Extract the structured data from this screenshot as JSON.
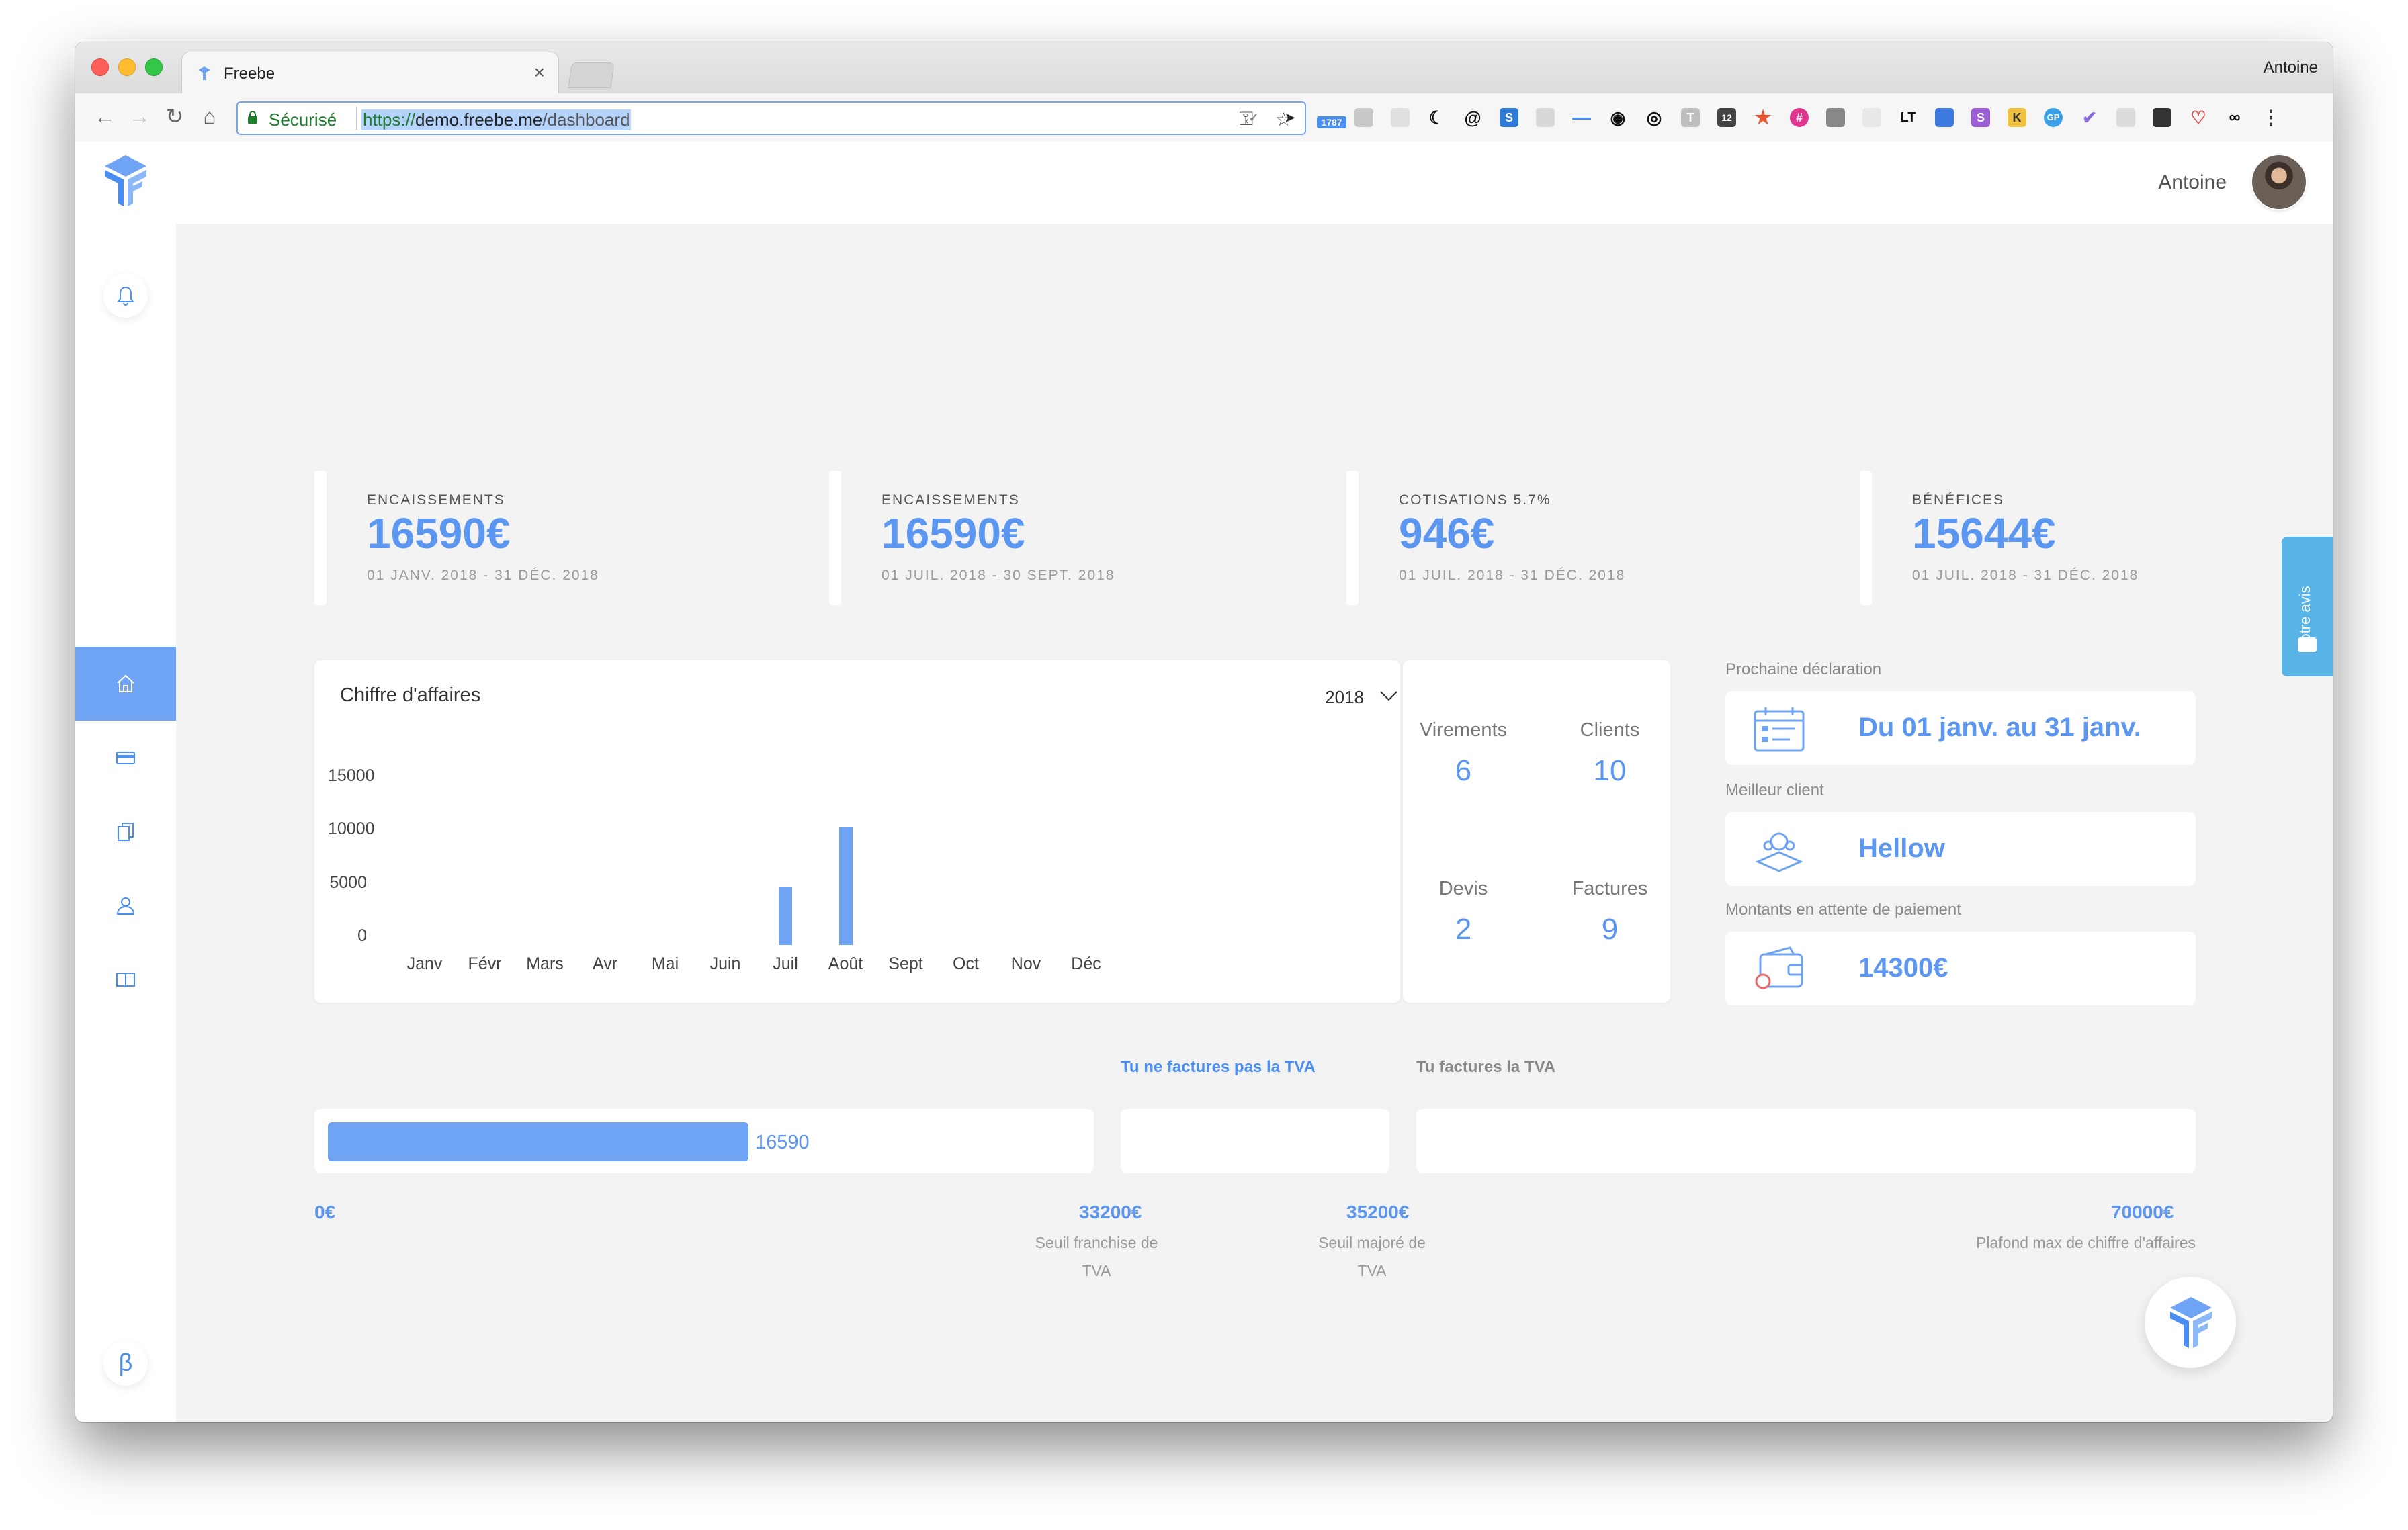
{
  "browser": {
    "tab_title": "Freebe",
    "tab_close": "×",
    "profile_name": "Antoine",
    "secure_label": "Sécurisé",
    "url_scheme": "https://",
    "url_host": "demo.freebe.me",
    "url_path": "/dashboard",
    "extension_badge": "1787",
    "extension_label_lt": "LT",
    "extension_label_12": "12",
    "extension_label_s": "S"
  },
  "header": {
    "user_name": "Antoine"
  },
  "sidebar": {
    "beta_label": "β",
    "items": [
      "home",
      "billing",
      "documents",
      "clients",
      "guide"
    ]
  },
  "stats": [
    {
      "label": "ENCAISSEMENTS",
      "value": "16590€",
      "period": "01 JANV. 2018 - 31 DÉC. 2018"
    },
    {
      "label": "ENCAISSEMENTS",
      "value": "16590€",
      "period": "01 JUIL. 2018 - 30 SEPT. 2018"
    },
    {
      "label": "COTISATIONS 5.7%",
      "value": "946€",
      "period": "01 JUIL. 2018 - 31 DÉC. 2018"
    },
    {
      "label": "BÉNÉFICES",
      "value": "15644€",
      "period": "01 JUIL. 2018 - 31 DÉC. 2018"
    }
  ],
  "revenue": {
    "title": "Chiffre d'affaires",
    "year": "2018"
  },
  "chart_data": {
    "type": "bar",
    "title": "Chiffre d'affaires",
    "categories": [
      "Janv",
      "Févr",
      "Mars",
      "Avr",
      "Mai",
      "Juin",
      "Juil",
      "Août",
      "Sept",
      "Oct",
      "Nov",
      "Déc"
    ],
    "values": [
      0,
      0,
      0,
      0,
      0,
      0,
      5500,
      11000,
      0,
      0,
      0,
      0
    ],
    "yticks": [
      "15000",
      "10000",
      "5000",
      "0"
    ],
    "ytick_values": [
      15000,
      10000,
      5000,
      0
    ],
    "ylim": [
      0,
      15000
    ],
    "bar_color": "#6fa3f4"
  },
  "kpis": [
    {
      "label": "Virements",
      "value": "6"
    },
    {
      "label": "Clients",
      "value": "10"
    },
    {
      "label": "Devis",
      "value": "2"
    },
    {
      "label": "Factures",
      "value": "9"
    }
  ],
  "side": {
    "next_declaration_label": "Prochaine déclaration",
    "next_declaration_value": "Du 01 janv. au 31 janv.",
    "best_client_label": "Meilleur client",
    "best_client_value": "Hellow",
    "pending_label": "Montants en attente de paiement",
    "pending_value": "14300€"
  },
  "tva": {
    "no_tva_link": "Tu ne factures pas la TVA",
    "tva_link": "Tu factures la TVA",
    "current_value": "16590",
    "current_fraction": 0.237,
    "start_label": "0€",
    "thresholds": [
      {
        "value": "33200€",
        "caption_line1": "Seuil franchise de",
        "caption_line2": "TVA"
      },
      {
        "value": "35200€",
        "caption_line1": "Seuil majoré de",
        "caption_line2": "TVA"
      },
      {
        "value": "70000€",
        "caption_line1": "Plafond max de chiffre d'affaires",
        "caption_line2": ""
      }
    ]
  },
  "feedback": {
    "label": "Votre avis"
  },
  "colors": {
    "accent": "#5b96f0",
    "bar": "#6fa3f4",
    "feedback": "#58b4e6",
    "background": "#f3f3f3"
  }
}
